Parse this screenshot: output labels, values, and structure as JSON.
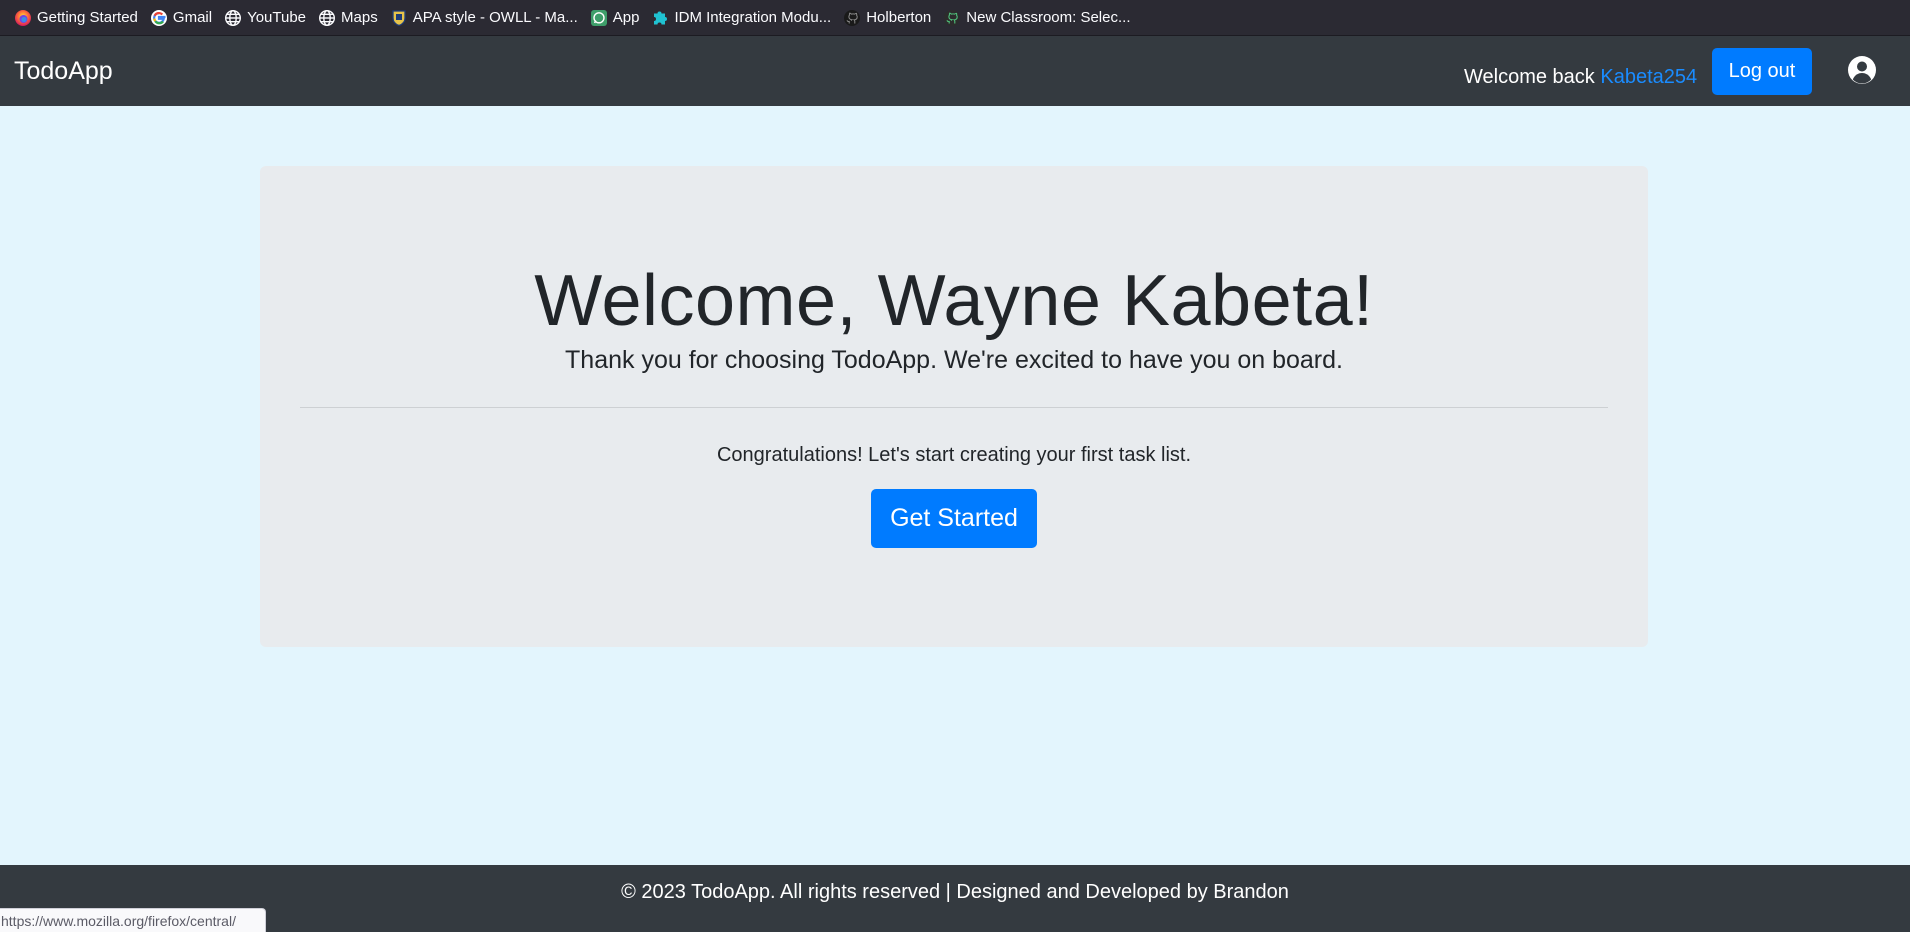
{
  "bookmarks": [
    {
      "label": "Getting Started",
      "icon": "firefox-icon"
    },
    {
      "label": "Gmail",
      "icon": "google-icon"
    },
    {
      "label": "YouTube",
      "icon": "globe-icon"
    },
    {
      "label": "Maps",
      "icon": "globe-icon"
    },
    {
      "label": "APA style - OWLL - Ma...",
      "icon": "crest-icon"
    },
    {
      "label": "App",
      "icon": "whatsapp-icon"
    },
    {
      "label": "IDM Integration Modu...",
      "icon": "puzzle-icon"
    },
    {
      "label": "Holberton",
      "icon": "github-icon"
    },
    {
      "label": "New Classroom: Selec...",
      "icon": "github-icon"
    }
  ],
  "navbar": {
    "brand": "TodoApp",
    "welcome_prefix": "Welcome back",
    "username": "Kabeta254",
    "logout_label": "Log out",
    "account_icon": "user-circle-icon"
  },
  "jumbotron": {
    "title": "Welcome, Wayne Kabeta!",
    "lead": "Thank you for choosing TodoApp. We're excited to have you on board.",
    "message": "Congratulations! Let's start creating your first task list.",
    "cta_label": "Get Started"
  },
  "footer": {
    "text": "© 2023 TodoApp. All rights reserved | Designed and Developed by Brandon"
  },
  "status_bar": {
    "url": "https://www.mozilla.org/firefox/central/"
  },
  "colors": {
    "page_background": "#e3f5fd",
    "navbar": "#343a40",
    "primary": "#007bff",
    "jumbotron": "#e8ebee"
  }
}
